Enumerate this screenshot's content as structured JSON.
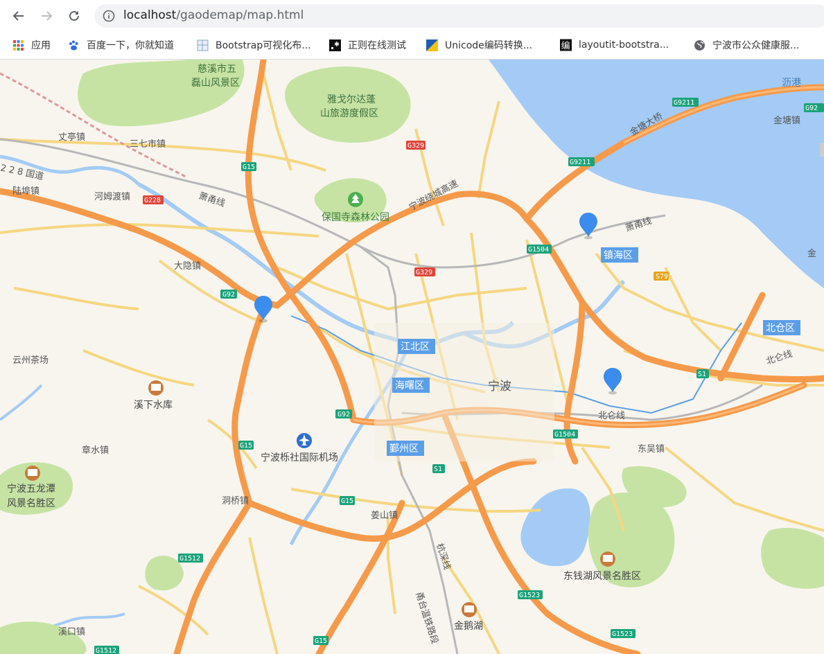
{
  "browser": {
    "url_host": "localhost",
    "url_path": "/gaodemap/map.html"
  },
  "bookmarks": [
    {
      "label": "应用",
      "icon": "apps-grid-icon"
    },
    {
      "label": "百度一下，你就知道",
      "icon": "baidu-paw-icon"
    },
    {
      "label": "Bootstrap可视化布...",
      "icon": "grid-layout-icon"
    },
    {
      "label": "正则在线测试",
      "icon": "regex-icon"
    },
    {
      "label": "Unicode编码转换...",
      "icon": "unicode-icon"
    },
    {
      "label": "layoutit-bootstra...",
      "icon": "bian-char-icon"
    },
    {
      "label": "宁波市公众健康服...",
      "icon": "globe-icon"
    }
  ],
  "map": {
    "city_label": "宁波",
    "districts": [
      "江北区",
      "海曙区",
      "鄞州区",
      "镇海区",
      "北仓区"
    ],
    "labels": {
      "cixi": "慈溪市五",
      "cixi2": "磊山风景区",
      "yage1": "雅戈尔达蓬",
      "yage2": "山旅游度假区",
      "zhangting": "丈亭镇",
      "sanqi": "三七市镇",
      "g228road": "2 2 8 国道",
      "luyan": "陆埠镇",
      "hemudu": "河姆渡镇",
      "xiaoyong": "萧甬线",
      "baoguo": "保国寺森林公园",
      "ringhigh": "宁波绕城高速",
      "dayin": "大隐镇",
      "yunzhou": "云州茶场",
      "xixia": "溪下水库",
      "zhangshui": "章水镇",
      "wulongtan1": "宁波五龙潭",
      "wulongtan2": "风景名胜区",
      "dongqiao": "洞桥镇",
      "airport": "宁波栎社国际机场",
      "jiangshan": "姜山镇",
      "hangshen1": "杭深线",
      "hangshen2": "甬台温铁路段",
      "dongqian": "东钱湖风景名胜区",
      "jine": "金鹅湖",
      "xikou": "溪口镇",
      "dongwu": "东吴镇",
      "beilunline": "北仑线",
      "beilunline2": "北仑线",
      "xiaoyong2": "萧甬线",
      "jintang_bridge": "金塘大桥",
      "jintangzhen": "金塘镇",
      "ligang": "沥港",
      "jin_edge": "金"
    },
    "shields": [
      {
        "text": "G15",
        "color": "#1aa37a"
      },
      {
        "text": "G329",
        "color": "#e0443a"
      },
      {
        "text": "G228",
        "color": "#e0443a"
      },
      {
        "text": "G92",
        "color": "#1aa37a"
      },
      {
        "text": "G1504",
        "color": "#1aa37a"
      },
      {
        "text": "G9211",
        "color": "#1aa37a"
      },
      {
        "text": "S79",
        "color": "#e6a41a"
      },
      {
        "text": "S1",
        "color": "#1aa37a"
      },
      {
        "text": "G1512",
        "color": "#1aa37a"
      },
      {
        "text": "G1523",
        "color": "#1aa37a"
      }
    ],
    "markers": [
      "marker-1",
      "marker-2",
      "marker-3"
    ],
    "colors": {
      "land": "#f8f5ee",
      "water": "#a3cbf5",
      "forest": "#c6e3a4",
      "highway": "#f59a4a",
      "road": "#f5d782",
      "marker": "#3b8ced",
      "district_label_bg": "#5b9ee8"
    }
  }
}
